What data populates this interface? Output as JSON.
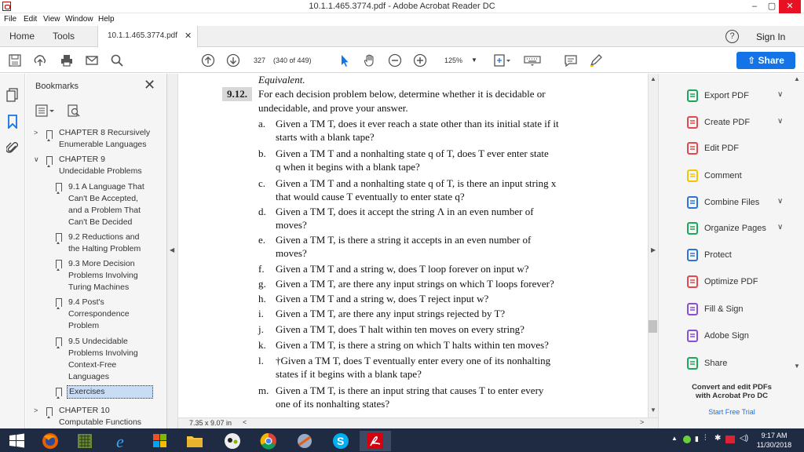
{
  "window": {
    "title": "10.1.1.465.3774.pdf - Adobe Acrobat Reader DC",
    "minimize": "–",
    "maximize": "▢",
    "close": "✕"
  },
  "menu": [
    "File",
    "Edit",
    "View",
    "Window",
    "Help"
  ],
  "tabs": {
    "home": "Home",
    "tools": "Tools",
    "doc": "10.1.1.465.3774.pdf",
    "doc_close": "✕",
    "help": "?",
    "sign_in": "Sign In"
  },
  "toolbar": {
    "page_number": "327",
    "page_of": "(340 of 449)",
    "zoom": "125%",
    "share": "Share"
  },
  "bookmarks": {
    "header": "Bookmarks",
    "close": "✕",
    "items": [
      {
        "line1": "CHAPTER 8 Recursively",
        "line2": "Enumerable Languages"
      },
      {
        "line1": "CHAPTER 9",
        "line2": "Undecidable Problems"
      },
      {
        "line1": "9.1 A Language That",
        "line2": "Can't Be Accepted,",
        "line3": "and a Problem That",
        "line4": "Can't Be Decided"
      },
      {
        "line1": "9.2 Reductions and",
        "line2": "the Halting Problem"
      },
      {
        "line1": "9.3 More Decision",
        "line2": "Problems Involving",
        "line3": "Turing Machines"
      },
      {
        "line1": "9.4 Post's",
        "line2": "Correspondence",
        "line3": "Problem"
      },
      {
        "line1": "9.5 Undecidable",
        "line2": "Problems Involving",
        "line3": "Context-Free",
        "line4": "Languages"
      },
      {
        "line1": "Exercises"
      },
      {
        "line1": "CHAPTER 10",
        "line2": "Computable Functions"
      }
    ]
  },
  "document": {
    "prev_line": "Equivalent.",
    "number": "9.12.",
    "intro1": "For each decision problem below, determine whether it is decidable or",
    "intro2": "undecidable, and prove your answer.",
    "items": [
      {
        "label": "a.",
        "l1": "Given a TM T, does it ever reach a state other than its initial state if it",
        "l2": "starts with a blank tape?"
      },
      {
        "label": "b.",
        "l1": "Given a TM T and a nonhalting state q of T, does T ever enter state",
        "l2": "q when it begins with a blank tape?"
      },
      {
        "label": "c.",
        "l1": "Given a TM T and a nonhalting state q of T, is there an input string x",
        "l2": "that would cause T eventually to enter state q?"
      },
      {
        "label": "d.",
        "l1": "Given a TM T, does it accept the string Λ in an even number of",
        "l2": "moves?"
      },
      {
        "label": "e.",
        "l1": "Given a TM T, is there a string it accepts in an even number of",
        "l2": "moves?"
      },
      {
        "label": "f.",
        "l1": "Given a TM T and a string w, does T loop forever on input w?"
      },
      {
        "label": "g.",
        "l1": "Given a TM T, are there any input strings on which T loops forever?"
      },
      {
        "label": "h.",
        "l1": "Given a TM T and a string w, does T reject input w?"
      },
      {
        "label": "i.",
        "l1": "Given a TM T, are there any input strings rejected by T?"
      },
      {
        "label": "j.",
        "l1": "Given a TM T, does T halt within ten moves on every string?"
      },
      {
        "label": "k.",
        "l1": "Given a TM T, is there a string on which T halts within ten moves?"
      },
      {
        "label": "l.",
        "l1": "†Given a TM T, does T eventually enter every one of its nonhalting",
        "l2": "states if it begins with a blank tape?"
      },
      {
        "label": "m.",
        "l1": "Given a TM T, is there an input string that causes T to enter every",
        "l2": "one of its nonhalting states?"
      }
    ],
    "page_size": "7.35 x 9.07 in"
  },
  "tools_pane": {
    "items": [
      {
        "label": "Export PDF",
        "icon": "export-pdf-icon",
        "color": "#1aa85a",
        "chevron": true
      },
      {
        "label": "Create PDF",
        "icon": "create-pdf-icon",
        "color": "#e34850",
        "chevron": true
      },
      {
        "label": "Edit PDF",
        "icon": "edit-pdf-icon",
        "color": "#e34850",
        "chevron": false
      },
      {
        "label": "Comment",
        "icon": "comment-icon",
        "color": "#f5c400",
        "chevron": false
      },
      {
        "label": "Combine Files",
        "icon": "combine-files-icon",
        "color": "#2d74da",
        "chevron": true
      },
      {
        "label": "Organize Pages",
        "icon": "organize-pages-icon",
        "color": "#1aa85a",
        "chevron": true
      },
      {
        "label": "Protect",
        "icon": "protect-icon",
        "color": "#2d74da",
        "chevron": false
      },
      {
        "label": "Optimize PDF",
        "icon": "optimize-pdf-icon",
        "color": "#e34850",
        "chevron": false
      },
      {
        "label": "Fill & Sign",
        "icon": "fill-sign-icon",
        "color": "#8a4fd8",
        "chevron": false
      },
      {
        "label": "Adobe Sign",
        "icon": "adobe-sign-icon",
        "color": "#8a4fd8",
        "chevron": false
      },
      {
        "label": "Share",
        "icon": "share-icon",
        "color": "#1aa85a",
        "chevron": false
      }
    ],
    "promo_title1": "Convert and edit PDFs",
    "promo_title2": "with Acrobat Pro DC",
    "promo_link": "Start Free Trial"
  },
  "taskbar": {
    "time": "9:17 AM",
    "date": "11/30/2018"
  },
  "colors": {
    "accent": "#1473e6",
    "taskbar": "#1e2b43",
    "close_red": "#e81123"
  }
}
